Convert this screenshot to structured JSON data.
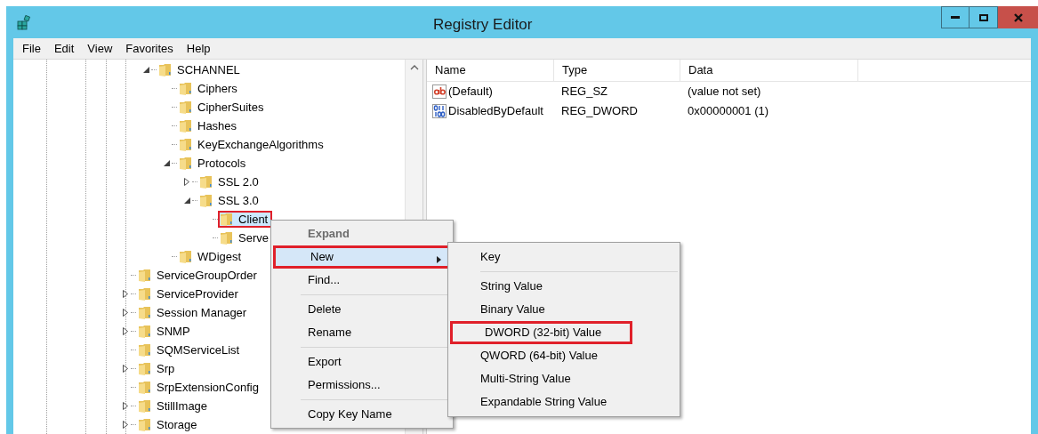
{
  "window": {
    "title": "Registry Editor"
  },
  "menu_bar": [
    "File",
    "Edit",
    "View",
    "Favorites",
    "Help"
  ],
  "tree": {
    "items": [
      {
        "children": [
          {
            "label": "SCHANNEL",
            "expanded": true,
            "selected": false,
            "highlighted": false,
            "children": [
              {
                "label": "Ciphers",
                "selected": false,
                "highlighted": false
              },
              {
                "label": "CipherSuites",
                "selected": false,
                "highlighted": false
              },
              {
                "label": "Hashes",
                "selected": false,
                "highlighted": false
              },
              {
                "label": "KeyExchangeAlgorithms",
                "selected": false,
                "highlighted": false
              },
              {
                "label": "Protocols",
                "expanded": true,
                "selected": false,
                "highlighted": false,
                "children": [
                  {
                    "label": "SSL 2.0",
                    "expanded": false,
                    "selected": false,
                    "highlighted": false
                  },
                  {
                    "label": "SSL 3.0",
                    "expanded": true,
                    "selected": false,
                    "highlighted": false,
                    "children": [
                      {
                        "label": "Client",
                        "selected": true,
                        "highlighted": true
                      },
                      {
                        "label": "Serve",
                        "selected": false,
                        "highlighted": false
                      }
                    ]
                  }
                ]
              },
              {
                "label": "WDigest",
                "selected": false,
                "highlighted": false
              }
            ]
          }
        ]
      },
      {
        "label": "ServiceGroupOrder",
        "selected": false,
        "highlighted": false
      },
      {
        "label": "ServiceProvider",
        "expanded": false,
        "selected": false,
        "highlighted": false
      },
      {
        "label": "Session Manager",
        "expanded": false,
        "selected": false,
        "highlighted": false
      },
      {
        "label": "SNMP",
        "expanded": false,
        "selected": false,
        "highlighted": false
      },
      {
        "label": "SQMServiceList",
        "selected": false,
        "highlighted": false
      },
      {
        "label": "Srp",
        "expanded": false,
        "selected": false,
        "highlighted": false
      },
      {
        "label": "SrpExtensionConfig",
        "selected": false,
        "highlighted": false
      },
      {
        "label": "StillImage",
        "expanded": false,
        "selected": false,
        "highlighted": false
      },
      {
        "label": "Storage",
        "expanded": false,
        "selected": false,
        "highlighted": false
      }
    ]
  },
  "values": {
    "columns": [
      "Name",
      "Type",
      "Data"
    ],
    "rows": [
      {
        "kind": "string",
        "name": "(Default)",
        "type": "REG_SZ",
        "data": "(value not set)"
      },
      {
        "kind": "binary",
        "name": "DisabledByDefault",
        "type": "REG_DWORD",
        "data": "0x00000001 (1)"
      }
    ]
  },
  "context_menu": {
    "items": [
      {
        "kind": "item",
        "label": "Expand",
        "disabled": true,
        "default": true,
        "selected": false,
        "highlighted": false,
        "submenu": false
      },
      {
        "kind": "item",
        "label": "New",
        "disabled": false,
        "default": false,
        "selected": true,
        "highlighted": true,
        "submenu": true
      },
      {
        "kind": "item",
        "label": "Find...",
        "disabled": false,
        "default": false,
        "selected": false,
        "highlighted": false,
        "submenu": false
      },
      {
        "kind": "separator"
      },
      {
        "kind": "item",
        "label": "Delete",
        "disabled": false,
        "default": false,
        "selected": false,
        "highlighted": false,
        "submenu": false
      },
      {
        "kind": "item",
        "label": "Rename",
        "disabled": false,
        "default": false,
        "selected": false,
        "highlighted": false,
        "submenu": false
      },
      {
        "kind": "separator"
      },
      {
        "kind": "item",
        "label": "Export",
        "disabled": false,
        "default": false,
        "selected": false,
        "highlighted": false,
        "submenu": false
      },
      {
        "kind": "item",
        "label": "Permissions...",
        "disabled": false,
        "default": false,
        "selected": false,
        "highlighted": false,
        "submenu": false
      },
      {
        "kind": "separator"
      },
      {
        "kind": "item",
        "label": "Copy Key Name",
        "disabled": false,
        "default": false,
        "selected": false,
        "highlighted": false,
        "submenu": false
      }
    ]
  },
  "submenu": {
    "items": [
      {
        "kind": "item",
        "label": "Key",
        "highlighted": false
      },
      {
        "kind": "separator"
      },
      {
        "kind": "item",
        "label": "String Value",
        "highlighted": false
      },
      {
        "kind": "item",
        "label": "Binary Value",
        "highlighted": false
      },
      {
        "kind": "item",
        "label": "DWORD (32-bit) Value",
        "highlighted": true
      },
      {
        "kind": "item",
        "label": "QWORD (64-bit) Value",
        "highlighted": false
      },
      {
        "kind": "item",
        "label": "Multi-String Value",
        "highlighted": false
      },
      {
        "kind": "item",
        "label": "Expandable String Value",
        "highlighted": false
      }
    ]
  }
}
